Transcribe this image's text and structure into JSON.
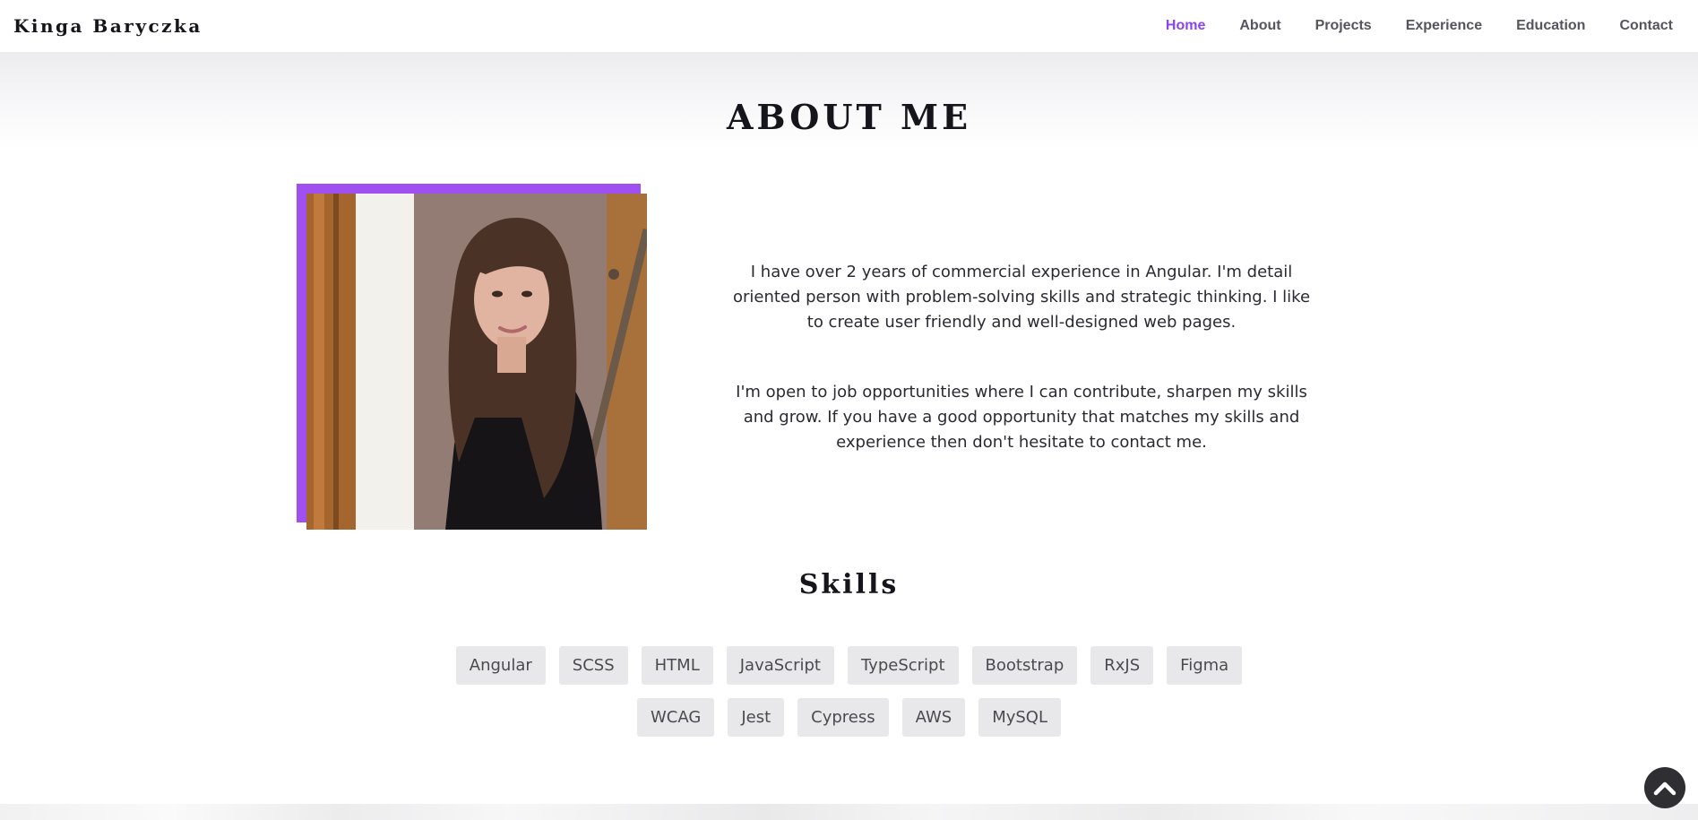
{
  "brand": {
    "name": "Kinga Baryczka"
  },
  "nav": {
    "items": [
      {
        "label": "Home",
        "active": true
      },
      {
        "label": "About",
        "active": false
      },
      {
        "label": "Projects",
        "active": false
      },
      {
        "label": "Experience",
        "active": false
      },
      {
        "label": "Education",
        "active": false
      },
      {
        "label": "Contact",
        "active": false
      }
    ]
  },
  "about": {
    "title": "ABOUT ME",
    "paragraphs": [
      "I have over 2 years of commercial experience in Angular. I'm detail oriented person with problem-solving skills and strategic thinking. I like to create user friendly and well-designed web pages.",
      "I'm open to job opportunities where I can contribute, sharpen my skills and grow. If you have a good opportunity that matches my skills and experience then don't hesitate to contact me."
    ]
  },
  "skills": {
    "title": "Skills",
    "items": [
      "Angular",
      "SCSS",
      "HTML",
      "JavaScript",
      "TypeScript",
      "Bootstrap",
      "RxJS",
      "Figma",
      "WCAG",
      "Jest",
      "Cypress",
      "AWS",
      "MySQL"
    ]
  },
  "icons": {
    "scroll_top": "chevron-up-icon"
  },
  "colors": {
    "accent": "#8b44f5",
    "photo_frame": "#a050f0",
    "skill_chip": "#e8e8ea",
    "scroll_button": "#2f2f33"
  }
}
